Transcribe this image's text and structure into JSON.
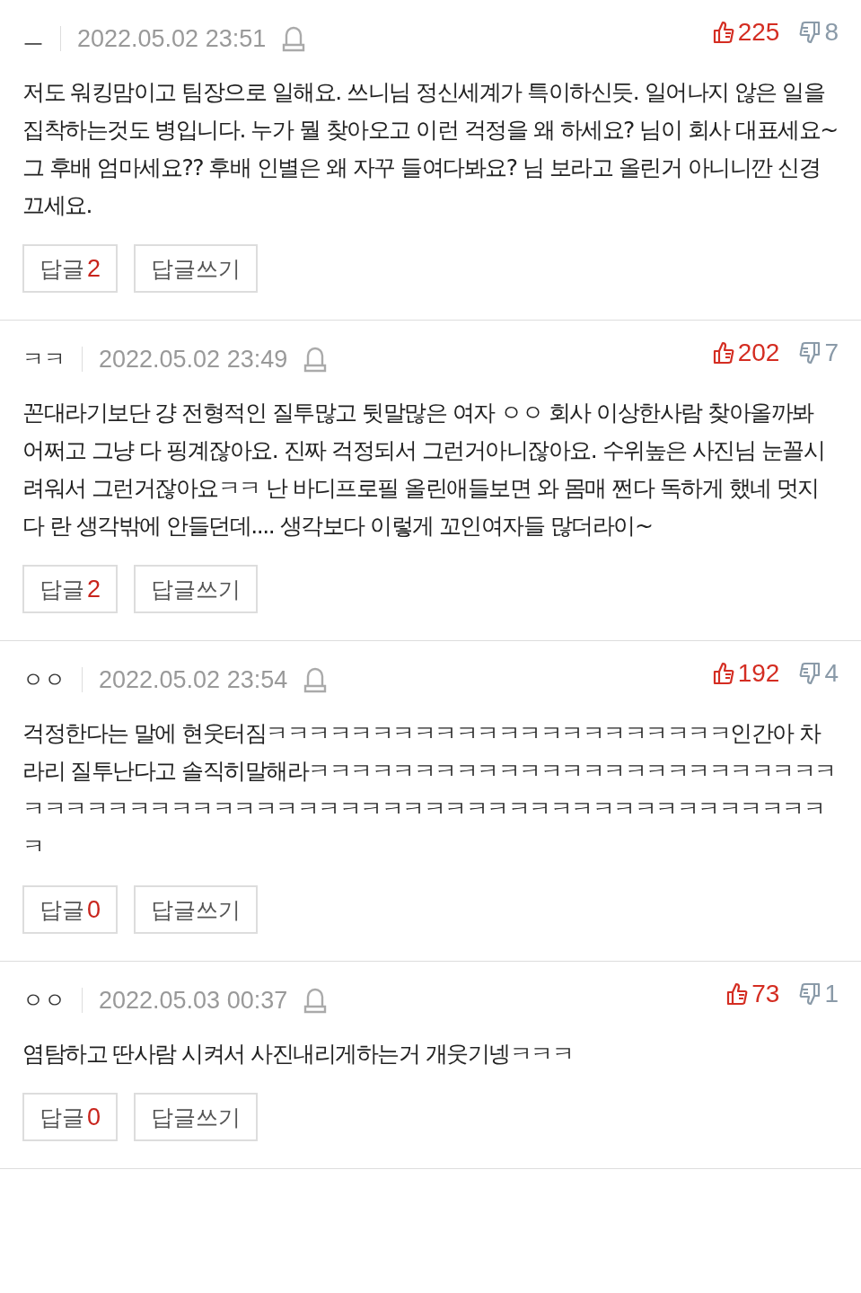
{
  "comments": [
    {
      "author": "ㅡ",
      "date": "2022.05.02 23:51",
      "likes": "225",
      "dislikes": "8",
      "text": "저도 워킹맘이고 팀장으로 일해요. 쓰니님 정신세계가 특이하신듯. 일어나지 않은 일을 집착하는것도 병입니다. 누가 뭘 찾아오고 이런 걱정을 왜 하세요? 님이 회사 대표세요~ 그 후배 엄마세요?? 후배 인별은 왜 자꾸 들여다봐요? 님 보라고 올린거 아니니깐 신경 끄세요.",
      "reply_label": "답글",
      "reply_count": "2",
      "write_label": "답글쓰기"
    },
    {
      "author": "ㅋㅋ",
      "date": "2022.05.02 23:49",
      "likes": "202",
      "dislikes": "7",
      "text": "꼰대라기보단 걍 전형적인 질투많고 뒷말많은 여자 ㅇㅇ 회사 이상한사람 찾아올까봐 어쩌고 그냥 다 핑계잖아요. 진짜 걱정되서 그런거아니잖아요. 수위높은 사진님 눈꼴시려워서 그런거잖아요ㅋㅋ 난 바디프로필 올린애들보면 와 몸매 쩐다 독하게 했네 멋지다 란 생각밖에 안들던데.... 생각보다 이렇게 꼬인여자들 많더라이~",
      "reply_label": "답글",
      "reply_count": "2",
      "write_label": "답글쓰기"
    },
    {
      "author": "ㅇㅇ",
      "date": "2022.05.02 23:54",
      "likes": "192",
      "dislikes": "4",
      "text": "걱정한다는 말에 현웃터짐ㅋㅋㅋㅋㅋㅋㅋㅋㅋㅋㅋㅋㅋㅋㅋㅋㅋㅋㅋㅋㅋㅋ인간아 차라리 질투난다고 솔직히말해라ㅋㅋㅋㅋㅋㅋㅋㅋㅋㅋㅋㅋㅋㅋㅋㅋㅋㅋㅋㅋㅋㅋㅋㅋㅋㅋㅋㅋㅋㅋㅋㅋㅋㅋㅋㅋㅋㅋㅋㅋㅋㅋㅋㅋㅋㅋㅋㅋㅋㅋㅋㅋㅋㅋㅋㅋㅋㅋㅋㅋㅋㅋㅋㅋ",
      "reply_label": "답글",
      "reply_count": "0",
      "write_label": "답글쓰기"
    },
    {
      "author": "ㅇㅇ",
      "date": "2022.05.03 00:37",
      "likes": "73",
      "dislikes": "1",
      "text": "염탐하고 딴사람 시켜서 사진내리게하는거 개웃기넹ㅋㅋㅋ",
      "reply_label": "답글",
      "reply_count": "0",
      "write_label": "답글쓰기"
    }
  ]
}
